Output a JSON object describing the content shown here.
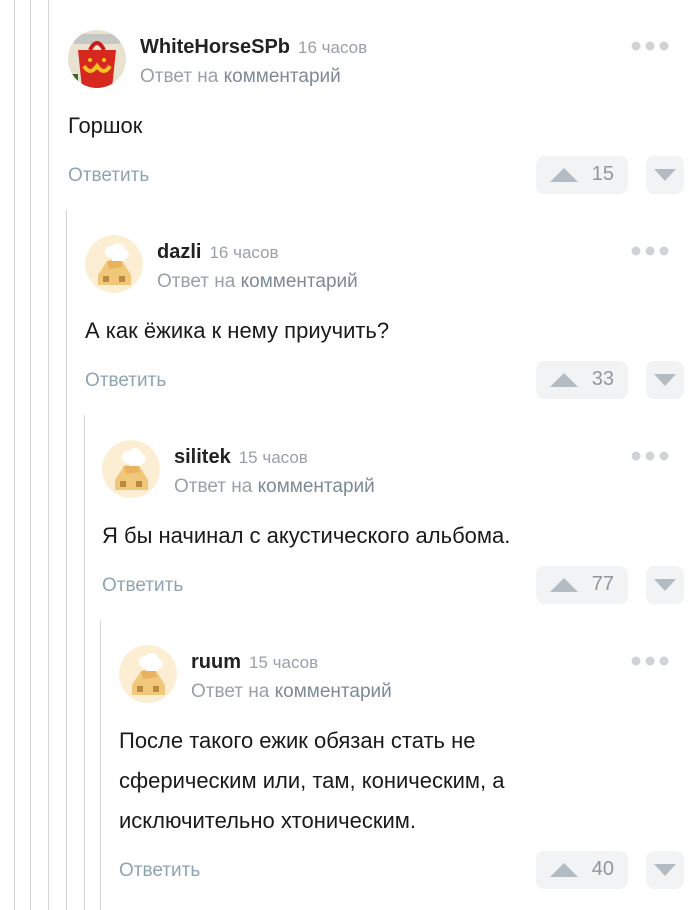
{
  "colors": {
    "accent": "#8ea4b1",
    "muted": "#9aa0a6",
    "line": "#d4d4d4",
    "button_bg": "#f2f3f4"
  },
  "comments": [
    {
      "username": "WhiteHorseSPb",
      "time": "16 часов",
      "reply_prefix": "Ответ на",
      "reply_link": "комментарий",
      "text": "Горшок",
      "reply_label": "Ответить",
      "score": "15",
      "avatar": "mcdonalds-happy-meal-avatar"
    },
    {
      "username": "dazli",
      "time": "16 часов",
      "reply_prefix": "Ответ на",
      "reply_link": "комментарий",
      "text": "А как ёжика к нему приучить?",
      "reply_label": "Ответить",
      "score": "33",
      "avatar": "default-chef-avatar"
    },
    {
      "username": "silitek",
      "time": "15 часов",
      "reply_prefix": "Ответ на",
      "reply_link": "комментарий",
      "text": "Я бы начинал с акустического альбома.",
      "reply_label": "Ответить",
      "score": "77",
      "avatar": "default-chef-avatar"
    },
    {
      "username": "ruum",
      "time": "15 часов",
      "reply_prefix": "Ответ на",
      "reply_link": "комментарий",
      "text_lines": [
        "После такого ежик обязан стать не",
        "сферическим или, там, коническим, а",
        "исключительно хтоническим."
      ],
      "reply_label": "Ответить",
      "score": "40",
      "avatar": "default-chef-avatar"
    }
  ]
}
